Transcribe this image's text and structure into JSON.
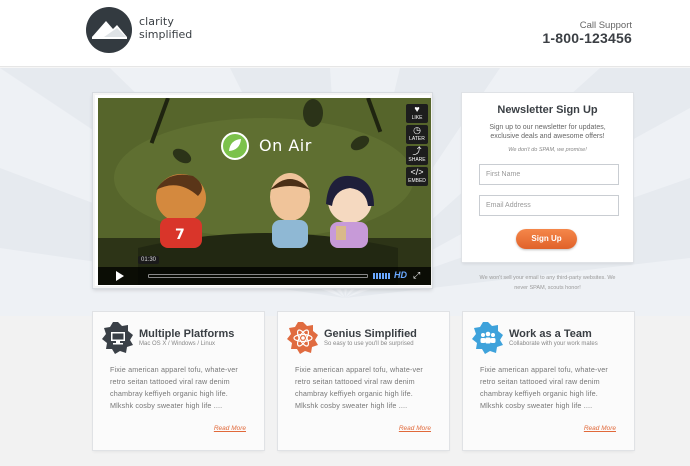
{
  "header": {
    "brand_line1": "clarity",
    "brand_line2": "simplified",
    "support_label": "Call Support",
    "support_number": "1-800-123456"
  },
  "video": {
    "on_air_text": "On Air",
    "side_buttons": [
      "LIKE",
      "LATER",
      "SHARE",
      "EMBED"
    ],
    "time": "01:30",
    "hd_label": "HD"
  },
  "signup": {
    "title": "Newsletter Sign Up",
    "description": "Sign up to our newsletter for updates, exclusive deals and awesome offers!",
    "nospam": "We don't do SPAM, we promise!",
    "first_name_placeholder": "First Name",
    "email_placeholder": "Email Address",
    "button": "Sign Up",
    "privacy": "We won't sell your email to any third-party websites. We never SPAM, scouts honor!"
  },
  "features": [
    {
      "title": "Multiple Platforms",
      "subtitle": "Mac OS X / Windows / Linux",
      "body": "Fixie american apparel tofu, whate-ver retro seitan tattooed viral raw denim chambray keffiyeh organic high life. Mlkshk cosby sweater high life ....",
      "more": "Read More"
    },
    {
      "title": "Genius Simplified",
      "subtitle": "So easy to use you'll be surprised",
      "body": "Fixie american apparel tofu, whate-ver retro seitan tattooed viral raw denim chambray keffiyeh organic high life. Mlkshk cosby sweater high life ....",
      "more": "Read More"
    },
    {
      "title": "Work as a Team",
      "subtitle": "Collaborate with your work mates",
      "body": "Fixie american apparel tofu, whate-ver retro seitan tattooed viral raw denim chambray keffiyeh organic high life. Mlkshk cosby sweater high life ....",
      "more": "Read More"
    }
  ],
  "colors": {
    "accent_orange": "#e9703a",
    "badge_dark": "#3a4047",
    "badge_orange": "#e06b40",
    "badge_blue": "#3ea2db"
  }
}
